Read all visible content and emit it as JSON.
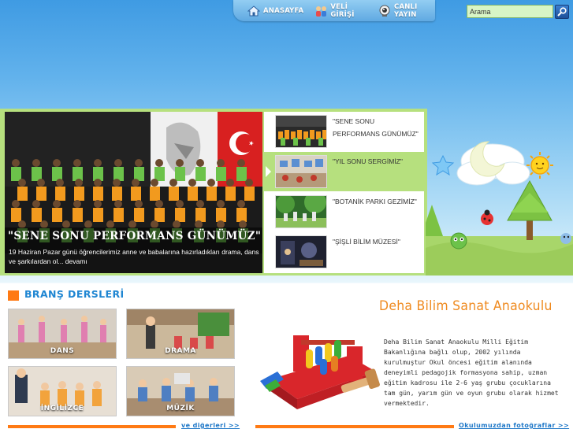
{
  "nav": {
    "items": [
      {
        "label": "ANASAYFA",
        "icon": "house-icon"
      },
      {
        "label": "VELİ GİRİŞİ",
        "icon": "parents-icon"
      },
      {
        "label": "CANLI YAYIN",
        "icon": "webcam-icon"
      }
    ]
  },
  "search": {
    "value": "Arama",
    "button_icon": "search-icon"
  },
  "slider": {
    "main_title": "\"SENE SONU PERFORMANS GÜNÜMÜZ\"",
    "main_text": "19 Haziran Pazar günü öğrencilerimiz anne ve babalarına hazırladıkları drama, dans ve şarkılardan ol... devamı",
    "items": [
      {
        "label": "\"SENE SONU PERFORMANS GÜNÜMÜZ\""
      },
      {
        "label": "\"YIL SONU SERGİMİZ\""
      },
      {
        "label": "\"BOTANİK PARKI GEZİMİZ\""
      },
      {
        "label": "\"ŞİŞLİ BİLİM MÜZESİ\""
      }
    ]
  },
  "branches": {
    "title": "BRANŞ DERSLERİ",
    "cards": [
      {
        "label": "DANS"
      },
      {
        "label": "DRAMA"
      },
      {
        "label": "İNGİLİZCE"
      },
      {
        "label": "MÜZİK"
      }
    ],
    "more_link": "ve diğerleri >>"
  },
  "school": {
    "title": "Deha Bilim Sanat Anaokulu",
    "text": "Deha Bilim Sanat Anaokulu Milli Eğitim Bakanlığına bağlı olup, 2002 yılında kurulmuştur Okul öncesi eğitim alanında deneyimli pedagojik formasyona sahip, uzman eğitim kadrosu ile 2-6 yaş grubu çocuklarına tam gün, yarım gün ve oyun grubu olarak  hizmet vermektedir.",
    "photos_link": "Okulumuzdan fotoğraflar >>"
  },
  "colors": {
    "accent_orange": "#ff7a14",
    "link_blue": "#1f78c8",
    "slider_green": "#b6e07e",
    "title_orange": "#ef8a1f"
  }
}
